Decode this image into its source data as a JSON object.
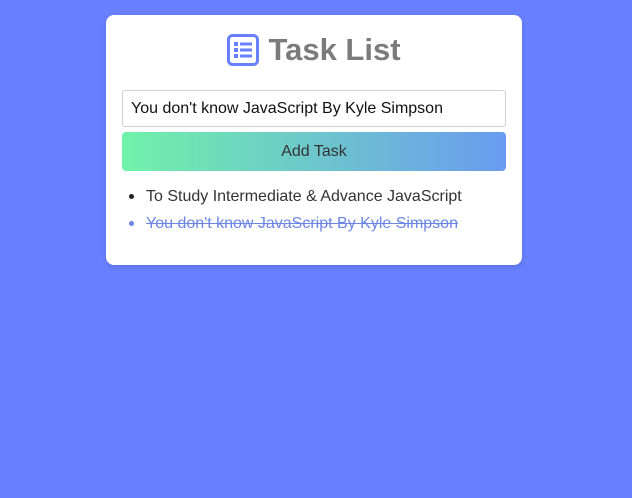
{
  "app": {
    "title": "Task List",
    "title_icon": "list-icon"
  },
  "form": {
    "input_value": "You don't know JavaScript By Kyle Simpson",
    "add_button_label": "Add Task"
  },
  "tasks": [
    {
      "label": "To Study Intermediate & Advance JavaScript",
      "completed": false
    },
    {
      "label": "You don't know JavaScript By Kyle Simpson",
      "completed": true
    }
  ],
  "colors": {
    "background": "#6880ff",
    "title_text": "#7b7b7b",
    "icon": "#6880ff",
    "completed_task": "#6b86e6",
    "button_gradient_start": "#70f2a8",
    "button_gradient_end": "#6a9bf0"
  }
}
